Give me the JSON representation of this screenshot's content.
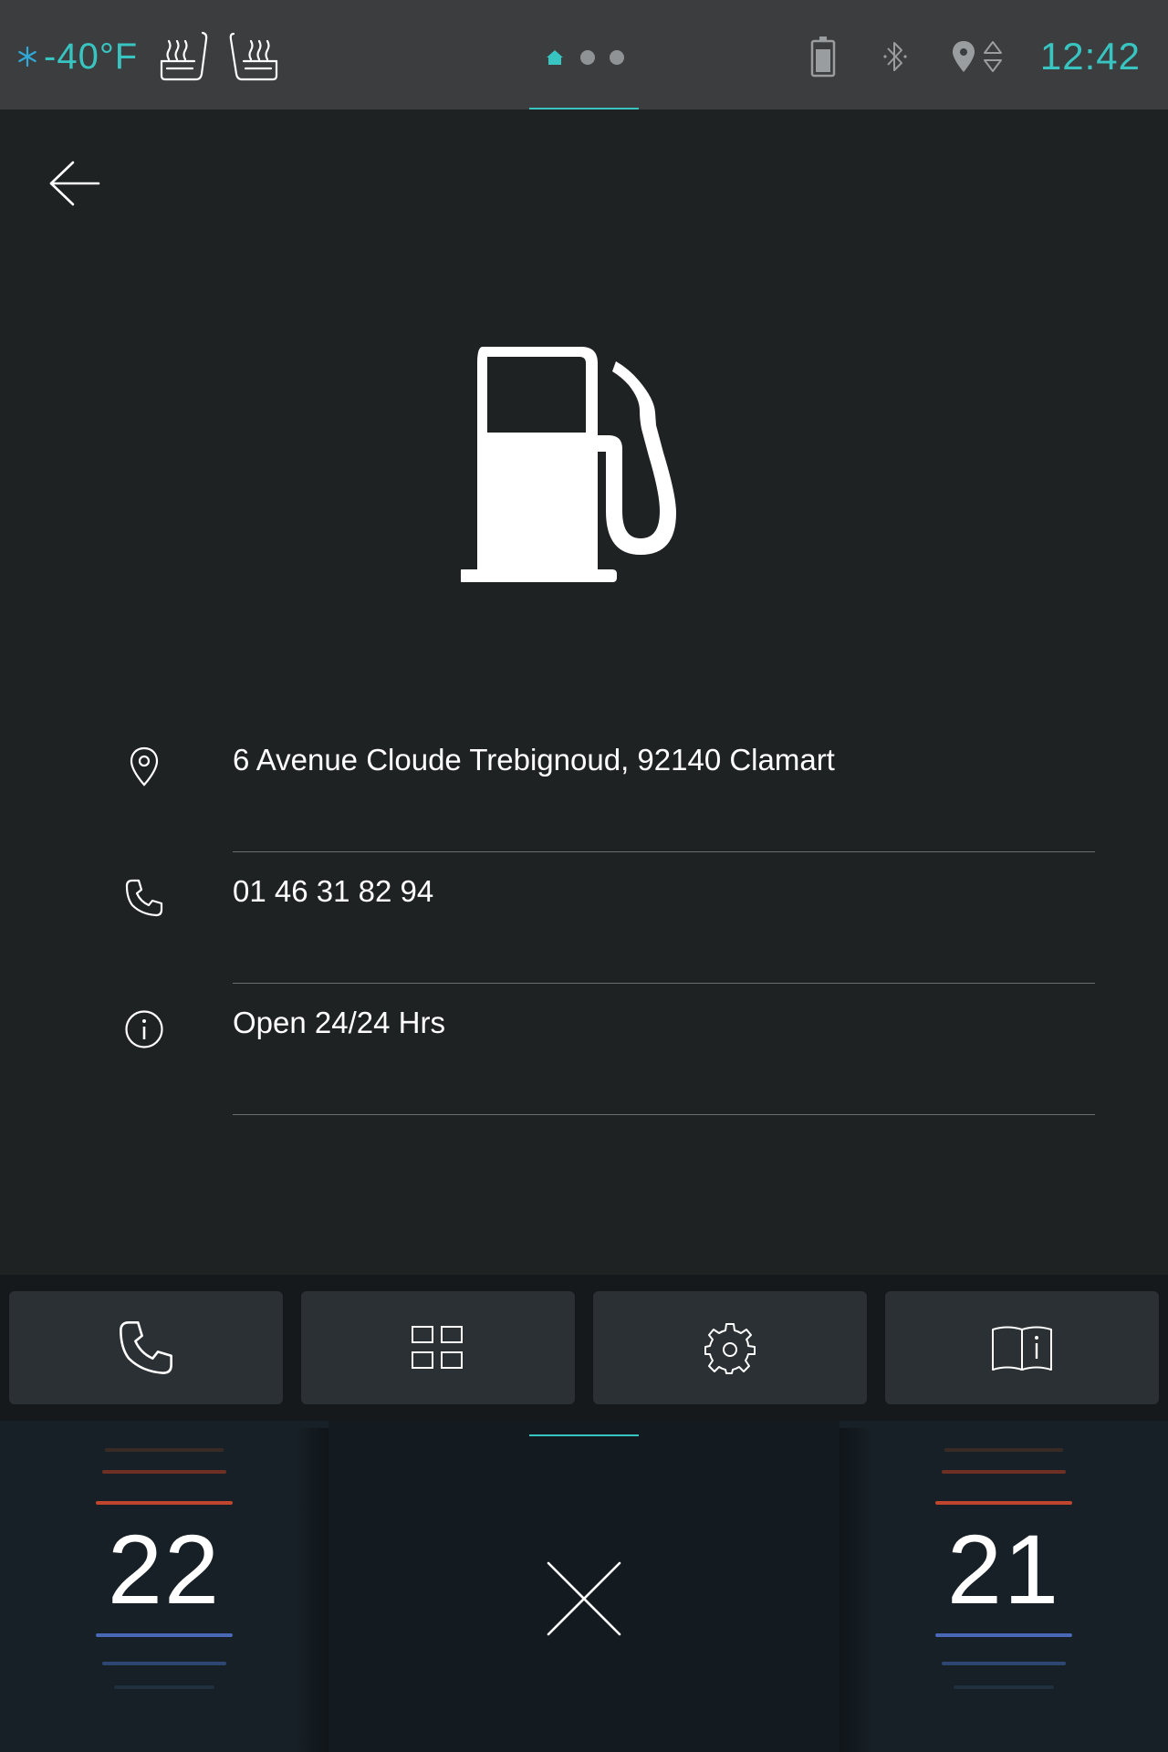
{
  "status_bar": {
    "outside_temperature": "-40°F",
    "time": "12:42",
    "page_count": 3,
    "active_page": 1,
    "icons": [
      "snowflake-icon",
      "heated-seat-icon",
      "seat-ventilation-icon",
      "home-icon",
      "battery-icon",
      "bluetooth-icon",
      "location-icon",
      "signal-arrows-icon"
    ],
    "accent_color": "#38c5c2"
  },
  "detail": {
    "icon": "fuel-pump-icon",
    "address": "6 Avenue Cloude Trebignoud, 92140 Clamart",
    "phone": "01 46 31 82 94",
    "hours": "Open 24/24 Hrs"
  },
  "shortcuts": [
    {
      "icon": "phone-icon"
    },
    {
      "icon": "apps-grid-icon"
    },
    {
      "icon": "settings-gear-icon"
    },
    {
      "icon": "manual-book-icon"
    }
  ],
  "climate": {
    "left_temperature": "22",
    "right_temperature": "21",
    "center_icon": "close-icon",
    "heat_color": "#c0452e",
    "cool_color": "#4a68b8"
  }
}
